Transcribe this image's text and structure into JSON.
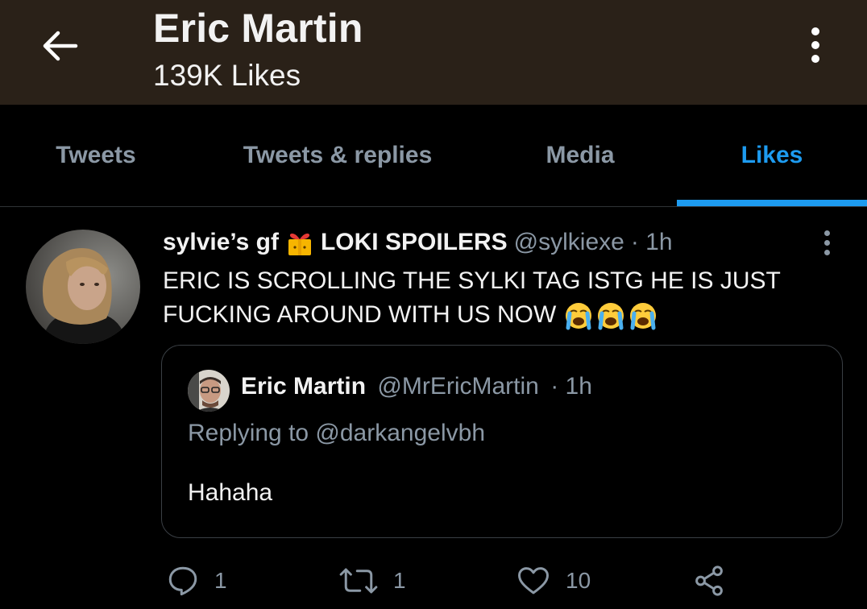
{
  "header": {
    "title": "Eric Martin",
    "subtitle": "139K Likes"
  },
  "tabs": [
    {
      "label": "Tweets",
      "active": false
    },
    {
      "label": "Tweets & replies",
      "active": false
    },
    {
      "label": "Media",
      "active": false
    },
    {
      "label": "Likes",
      "active": true
    }
  ],
  "tweet": {
    "author_name_1": "sylvie’s gf",
    "author_name_2": "LOKI SPOILERS",
    "handle": "@sylkiexe",
    "time": "· 1h",
    "text": "ERIC IS SCROLLING THE SYLKI TAG ISTG HE IS JUST FUCKING AROUND WITH US NOW",
    "quote": {
      "author_name": "Eric Martin",
      "handle": "@MrEricMartin",
      "time": "· 1h",
      "replying_to": "Replying to @darkangelvbh",
      "text": "Hahaha"
    },
    "counts": {
      "replies": "1",
      "retweets": "1",
      "likes": "10"
    }
  },
  "colors": {
    "accent": "#1d9bf0",
    "header_bg": "#2a2118",
    "muted": "#8b98a5"
  }
}
